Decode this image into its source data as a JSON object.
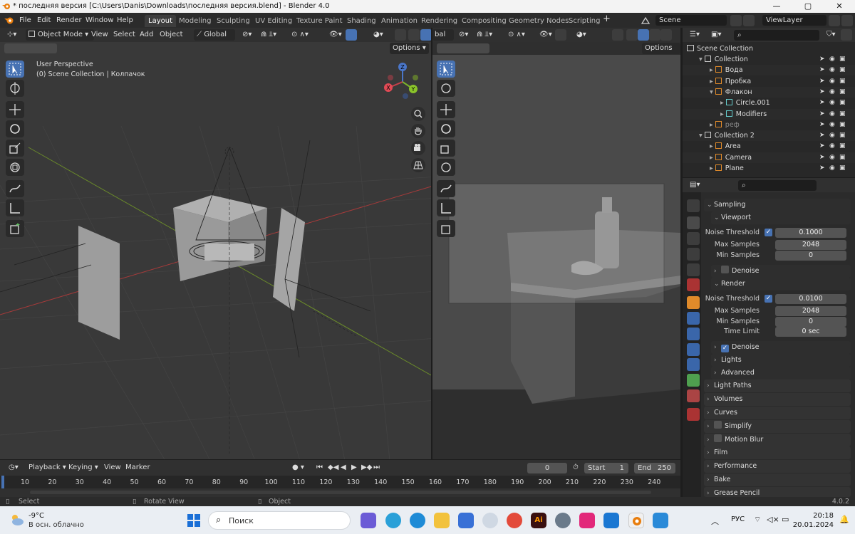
{
  "window": {
    "title": "* последняя версия [C:\\Users\\Danis\\Downloads\\последняя версия.blend] - Blender 4.0"
  },
  "menu": {
    "items": [
      "File",
      "Edit",
      "Render",
      "Window",
      "Help"
    ],
    "workspaces": [
      "Layout",
      "Modeling",
      "Sculpting",
      "UV Editing",
      "Texture Paint",
      "Shading",
      "Animation",
      "Rendering",
      "Compositing",
      "Geometry Nodes",
      "Scripting"
    ],
    "scene": "Scene",
    "view_layer": "ViewLayer"
  },
  "viewport_left": {
    "mode": "Object Mode",
    "menus": [
      "View",
      "Select",
      "Add",
      "Object"
    ],
    "transform": "Global",
    "options": "Options",
    "overlay_line1": "User Perspective",
    "overlay_line2": "(0) Scene Collection | Колпачок",
    "gizmo": {
      "x": "X",
      "y": "Y",
      "z": "Z"
    }
  },
  "viewport_right": {
    "transform": "bal",
    "options": "Options"
  },
  "outliner": {
    "root": "Scene Collection",
    "rows": [
      {
        "label": "Collection",
        "indent": 1
      },
      {
        "label": "Вода",
        "indent": 2
      },
      {
        "label": "Пробка",
        "indent": 2
      },
      {
        "label": "Флакон",
        "indent": 2
      },
      {
        "label": "Circle.001",
        "indent": 3
      },
      {
        "label": "Modifiers",
        "indent": 3
      },
      {
        "label": "реф",
        "indent": 2
      },
      {
        "label": "Collection 2",
        "indent": 1
      },
      {
        "label": "Area",
        "indent": 2
      },
      {
        "label": "Camera",
        "indent": 2
      },
      {
        "label": "Plane",
        "indent": 2
      }
    ]
  },
  "properties": {
    "sampling": "Sampling",
    "viewport": "Viewport",
    "vp_noise_label": "Noise Threshold",
    "vp_noise": "0.1000",
    "vp_max_label": "Max Samples",
    "vp_max": "2048",
    "vp_min_label": "Min Samples",
    "vp_min": "0",
    "vp_denoise": "Denoise",
    "render": "Render",
    "r_noise_label": "Noise Threshold",
    "r_noise": "0.0100",
    "r_max_label": "Max Samples",
    "r_max": "2048",
    "r_min_label": "Min Samples",
    "r_min": "0",
    "r_time_label": "Time Limit",
    "r_time": "0 sec",
    "r_denoise": "Denoise",
    "lights": "Lights",
    "advanced": "Advanced",
    "sections": [
      "Light Paths",
      "Volumes",
      "Curves",
      "Simplify",
      "Motion Blur",
      "Film",
      "Performance",
      "Bake",
      "Grease Pencil"
    ]
  },
  "timeline": {
    "menus": [
      "Playback",
      "Keying",
      "View",
      "Marker"
    ],
    "current_frame": "0",
    "start_label": "Start",
    "start": "1",
    "end_label": "End",
    "end": "250",
    "frames": [
      "10",
      "20",
      "30",
      "40",
      "50",
      "60",
      "70",
      "80",
      "90",
      "100",
      "110",
      "120",
      "130",
      "140",
      "150",
      "160",
      "170",
      "180",
      "190",
      "200",
      "210",
      "220",
      "230",
      "240"
    ]
  },
  "status": {
    "select": "Select",
    "rotate": "Rotate View",
    "object": "Object",
    "version": "4.0.2"
  },
  "taskbar": {
    "temp": "-9°C",
    "weather": "В осн. облачно",
    "search": "Поиск",
    "lang": "РУС",
    "time": "20:18",
    "date": "20.01.2024"
  }
}
